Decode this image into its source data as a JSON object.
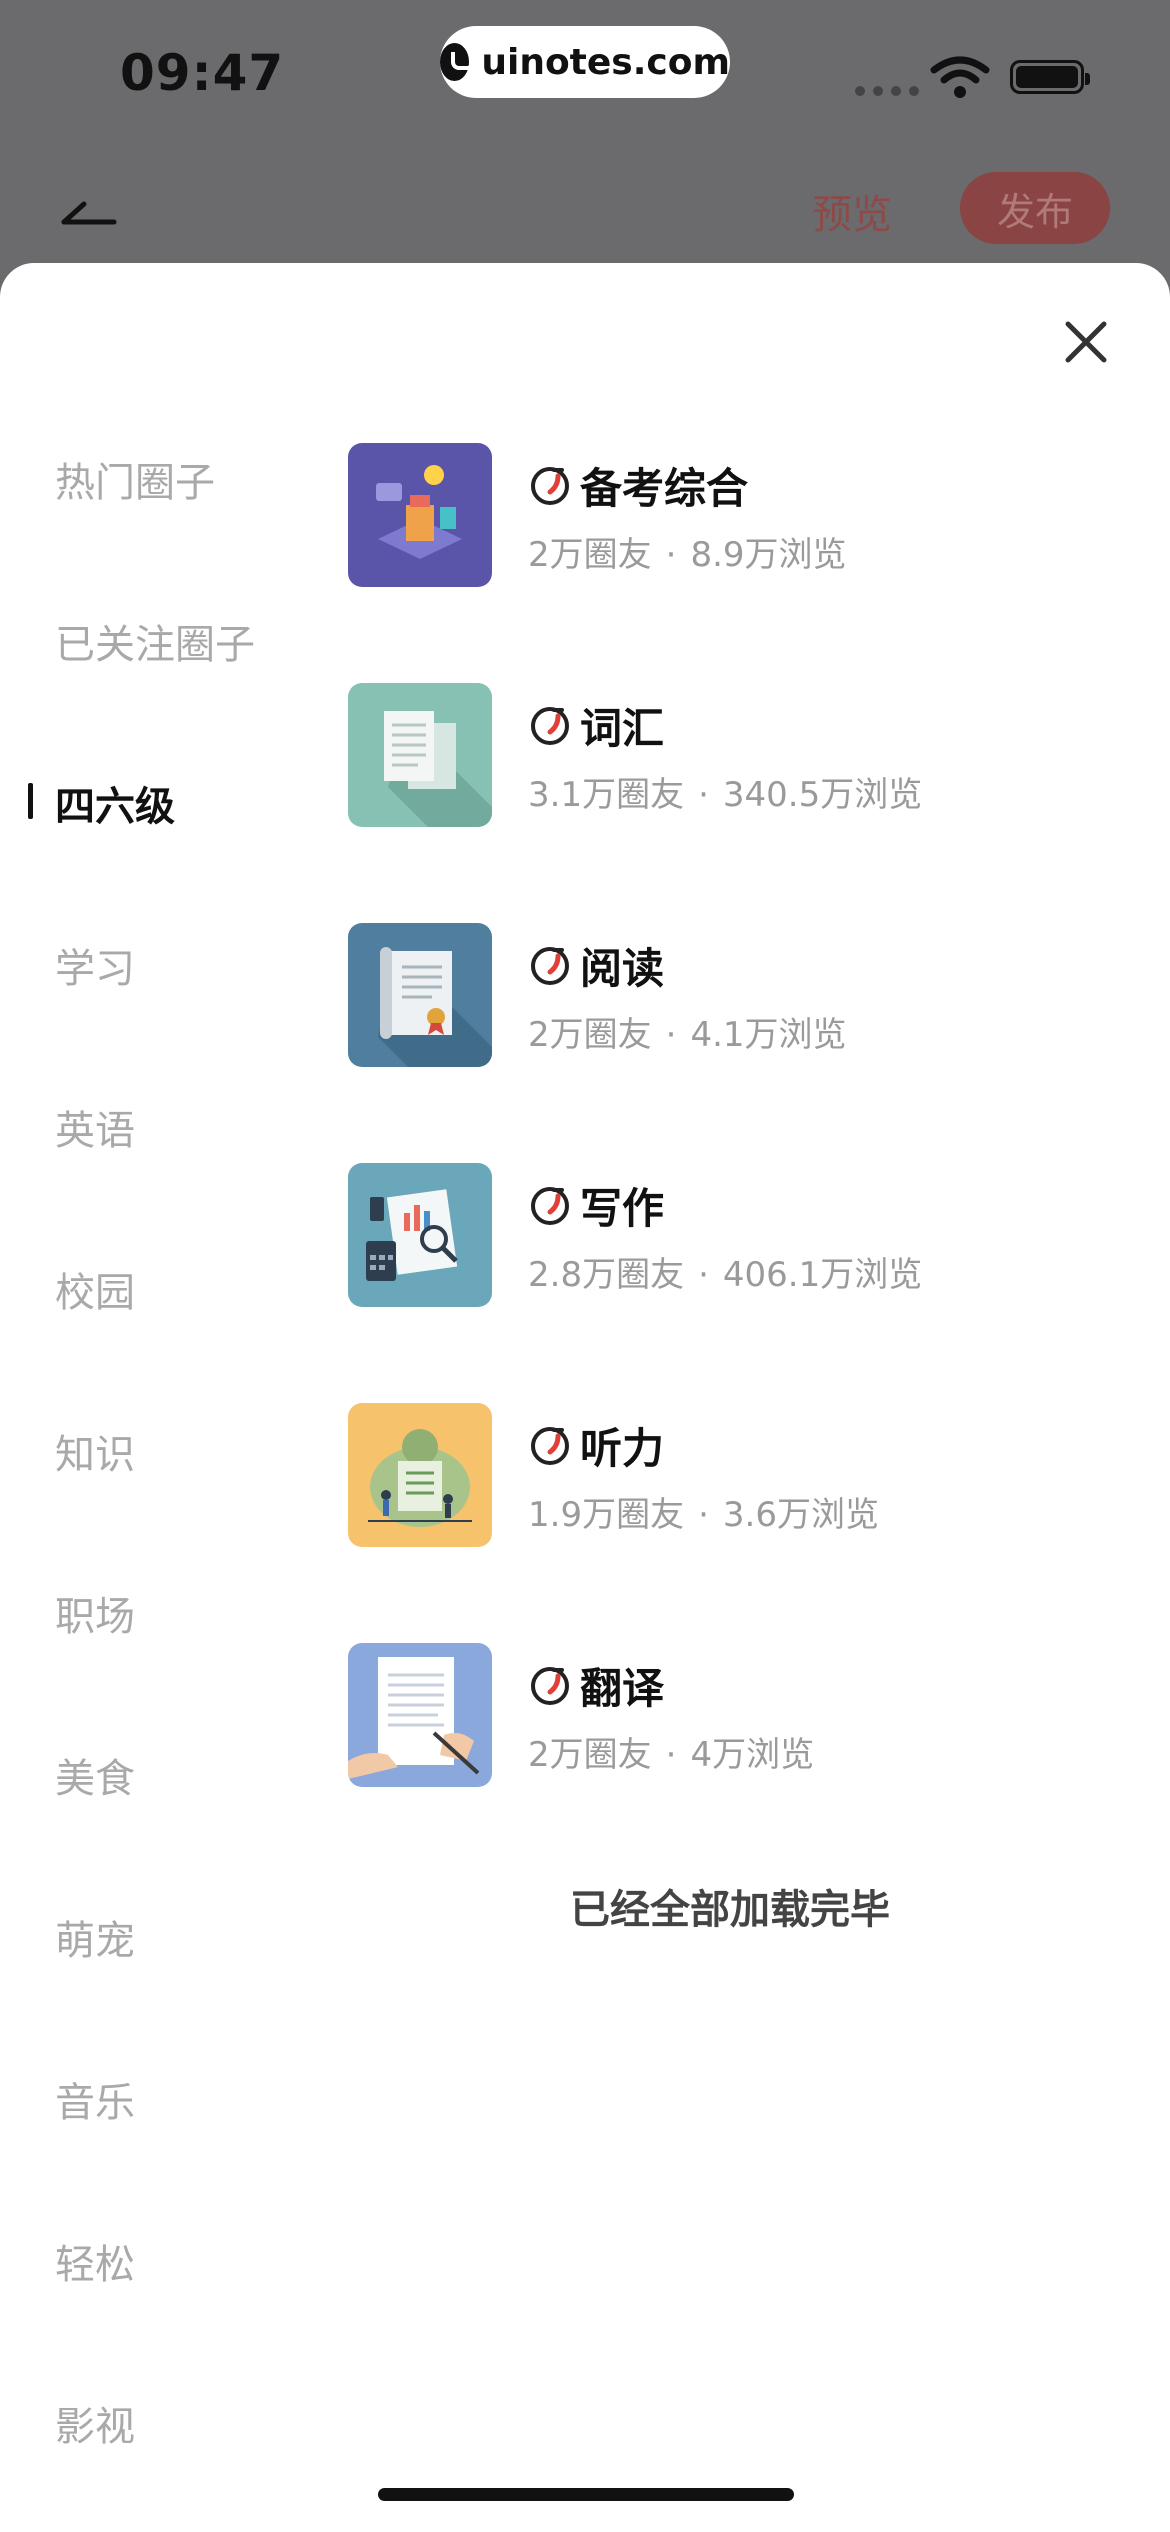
{
  "status_bar": {
    "time": "09:47",
    "url": "uinotes.com"
  },
  "nav": {
    "preview_label": "预览",
    "publish_label": "发布"
  },
  "side_nav": {
    "items": [
      {
        "label": "热门圈子",
        "active": false
      },
      {
        "label": "已关注圈子",
        "active": false
      },
      {
        "label": "四六级",
        "active": true
      },
      {
        "label": "学习",
        "active": false
      },
      {
        "label": "英语",
        "active": false
      },
      {
        "label": "校园",
        "active": false
      },
      {
        "label": "知识",
        "active": false
      },
      {
        "label": "职场",
        "active": false
      },
      {
        "label": "美食",
        "active": false
      },
      {
        "label": "萌宠",
        "active": false
      },
      {
        "label": "音乐",
        "active": false
      },
      {
        "label": "轻松",
        "active": false
      },
      {
        "label": "影视",
        "active": false
      }
    ]
  },
  "circles": [
    {
      "title": "备考综合",
      "members": "2万圈友",
      "views": "8.9万浏览",
      "icon": "exam-prep-illustration",
      "bg": "#5a55a8"
    },
    {
      "title": "词汇",
      "members": "3.1万圈友",
      "views": "340.5万浏览",
      "icon": "documents-illustration",
      "bg": "#86c1b3"
    },
    {
      "title": "阅读",
      "members": "2万圈友",
      "views": "4.1万浏览",
      "icon": "certificate-scroll-illustration",
      "bg": "#4f7e9e"
    },
    {
      "title": "写作",
      "members": "2.8万圈友",
      "views": "406.1万浏览",
      "icon": "analysis-desk-illustration",
      "bg": "#6aa7ba"
    },
    {
      "title": "听力",
      "members": "1.9万圈友",
      "views": "3.6万浏览",
      "icon": "checklist-team-illustration",
      "bg": "#f6c36c"
    },
    {
      "title": "翻译",
      "members": "2万圈友",
      "views": "4万浏览",
      "icon": "signing-paper-illustration",
      "bg": "#8aa8dc"
    }
  ],
  "list_end_text": "已经全部加载完毕",
  "colors": {
    "accent_red": "#e0403a",
    "active_text": "#111111",
    "inactive_text": "#a9a9a9"
  }
}
